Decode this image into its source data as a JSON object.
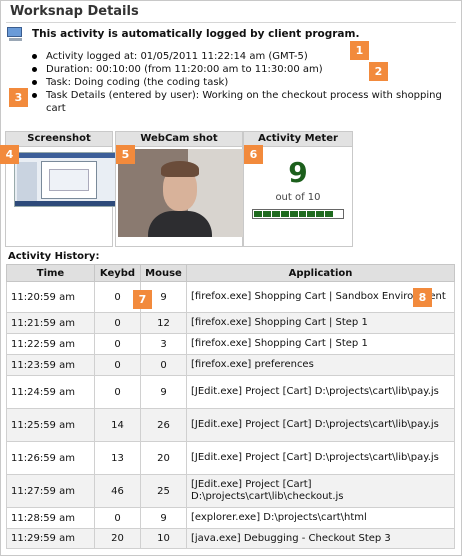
{
  "page": {
    "title": "Worksnap Details",
    "auto_logged": "This activity is automatically logged by client program."
  },
  "details": [
    "Activity logged at: 01/05/2011 11:22:14 am (GMT-5)",
    "Duration: 00:10:00 (from 11:20:00 am to 11:30:00 am)",
    "Task: Doing coding (the coding task)",
    "Task Details (entered by user): Working on the checkout process with shopping cart"
  ],
  "callouts": [
    "1",
    "2",
    "3",
    "4",
    "5",
    "6",
    "7",
    "8"
  ],
  "panels": {
    "screenshot": "Screenshot",
    "webcam": "WebCam shot",
    "meter": "Activity Meter"
  },
  "meter": {
    "value": "9",
    "out_of": "out of 10",
    "level": 9,
    "max": 10,
    "fill_color": "#1e6a1e"
  },
  "history": {
    "title": "Activity History:",
    "columns": [
      "Time",
      "Keybd",
      "Mouse",
      "Application"
    ],
    "rows": [
      {
        "time": "11:20:59 am",
        "keybd": "0",
        "mouse": "9",
        "app": "[firefox.exe] Shopping Cart | Sandbox Environment"
      },
      {
        "time": "11:21:59 am",
        "keybd": "0",
        "mouse": "12",
        "app": "[firefox.exe] Shopping Cart | Step 1"
      },
      {
        "time": "11:22:59 am",
        "keybd": "0",
        "mouse": "3",
        "app": "[firefox.exe] Shopping Cart | Step 1"
      },
      {
        "time": "11:23:59 am",
        "keybd": "0",
        "mouse": "0",
        "app": "[firefox.exe] preferences"
      },
      {
        "time": "11:24:59 am",
        "keybd": "0",
        "mouse": "9",
        "app": "[JEdit.exe] Project [Cart] D:\\projects\\cart\\lib\\pay.js"
      },
      {
        "time": "11:25:59 am",
        "keybd": "14",
        "mouse": "26",
        "app": "[JEdit.exe] Project [Cart] D:\\projects\\cart\\lib\\pay.js"
      },
      {
        "time": "11:26:59 am",
        "keybd": "13",
        "mouse": "20",
        "app": "[JEdit.exe] Project [Cart] D:\\projects\\cart\\lib\\pay.js"
      },
      {
        "time": "11:27:59 am",
        "keybd": "46",
        "mouse": "25",
        "app": "[JEdit.exe] Project [Cart] D:\\projects\\cart\\lib\\checkout.js"
      },
      {
        "time": "11:28:59 am",
        "keybd": "0",
        "mouse": "9",
        "app": "[explorer.exe] D:\\projects\\cart\\html"
      },
      {
        "time": "11:29:59 am",
        "keybd": "20",
        "mouse": "10",
        "app": "[java.exe] Debugging - Checkout Step 3"
      }
    ]
  },
  "colors": {
    "callout": "#f28a3c",
    "header_bg": "#e2e2e2",
    "meter_number": "#1c5f1c"
  },
  "icons": [
    "computer-icon"
  ]
}
